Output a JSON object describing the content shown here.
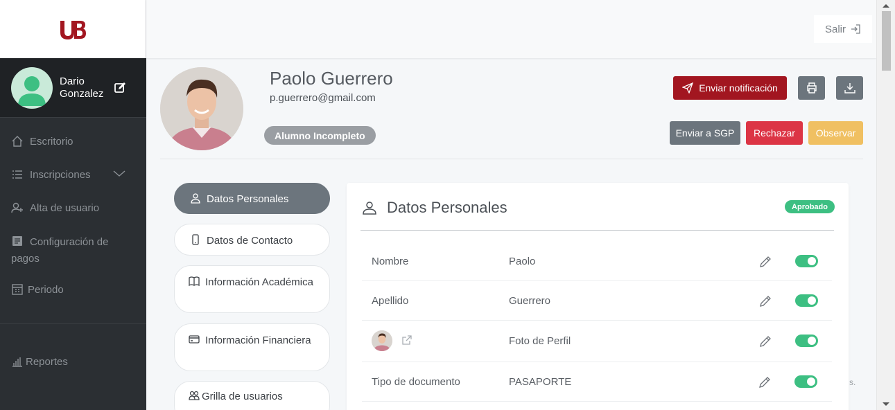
{
  "sidebar": {
    "logo_text": "UB",
    "user_name": "Dario Gonzalez",
    "items": [
      {
        "label": "Escritorio",
        "icon": "home-icon"
      },
      {
        "label": "Inscripciones",
        "icon": "list-icon"
      },
      {
        "label": "Alta de usuario",
        "icon": "user-add-icon"
      },
      {
        "label": "Configuración de pagos",
        "icon": "card-icon"
      },
      {
        "label": "Periodo",
        "icon": "calendar-icon"
      }
    ],
    "reports": {
      "label": "Reportes",
      "icon": "bar-chart-icon"
    }
  },
  "header": {
    "logout_label": "Salir"
  },
  "profile": {
    "name": "Paolo Guerrero",
    "email": "p.guerrero@gmail.com",
    "status": "Alumno Incompleto"
  },
  "actions": {
    "notify": "Enviar notificación",
    "send_sgp": "Enviar a SGP",
    "reject": "Rechazar",
    "observe": "Observar"
  },
  "tabs": [
    {
      "label": "Datos Personales",
      "icon": "user-icon"
    },
    {
      "label": "Datos de Contacto",
      "icon": "phone-icon"
    },
    {
      "label": "Información Académica",
      "icon": "book-icon"
    },
    {
      "label": "Información Financiera",
      "icon": "card-icon"
    },
    {
      "label": "Grilla de usuarios",
      "icon": "users-icon"
    }
  ],
  "card": {
    "title": "Datos Personales",
    "badge": "Aprobado",
    "rows": [
      {
        "label": "Nombre",
        "value": "Paolo",
        "enabled": true
      },
      {
        "label": "Apellido",
        "value": "Guerrero",
        "enabled": true
      },
      {
        "label": "",
        "value": "Foto de Perfil",
        "enabled": true
      },
      {
        "label": "Tipo de documento",
        "value": "PASAPORTE",
        "enabled": true
      }
    ]
  },
  "stray_text": "s.",
  "colors": {
    "brand": "#a21620",
    "sidebar_bg": "#2b2f33",
    "success": "#3dbf82",
    "danger": "#dc3545",
    "warning": "#f0c062",
    "secondary": "#6c757d"
  }
}
